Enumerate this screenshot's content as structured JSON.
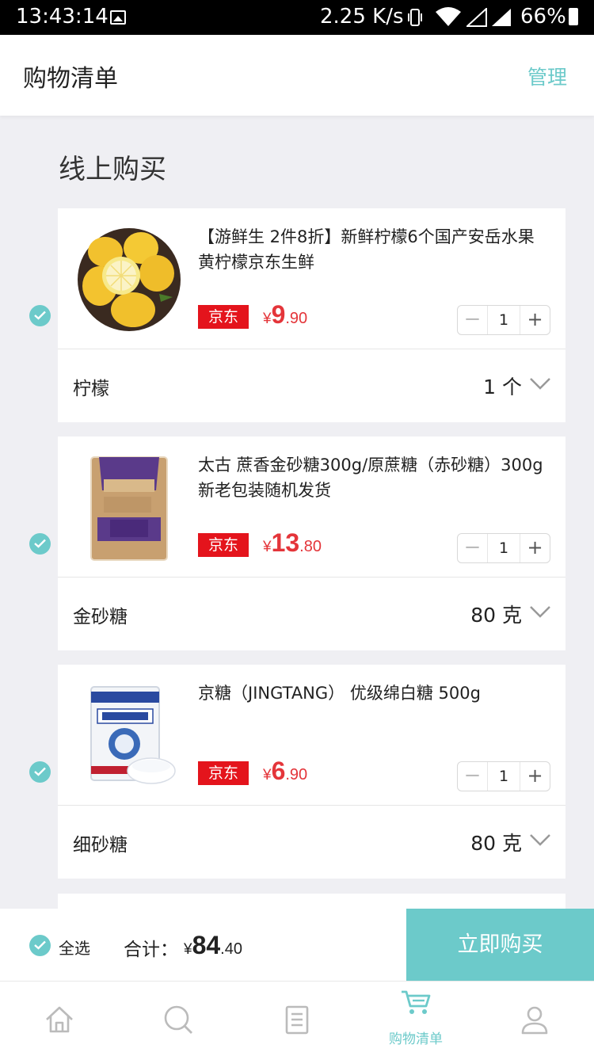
{
  "status_bar": {
    "time": "13:43:14",
    "speed": "2.25 K/s",
    "battery": "66%"
  },
  "header": {
    "title": "购物清单",
    "manage_label": "管理"
  },
  "section": {
    "title": "线上购买"
  },
  "items": [
    {
      "name": "【游鲜生 2件8折】新鲜柠檬6个国产安岳水果黄柠檬京东生鲜",
      "badge": "京东",
      "currency": "¥",
      "price_int": "9",
      "price_dec": ".90",
      "quantity": "1",
      "spec_label": "柠檬",
      "spec_value": "1 个",
      "selected": true
    },
    {
      "name": "太古 蔗香金砂糖300g/原蔗糖（赤砂糖）300g 新老包装随机发货",
      "badge": "京东",
      "currency": "¥",
      "price_int": "13",
      "price_dec": ".80",
      "quantity": "1",
      "spec_label": "金砂糖",
      "spec_value": "80 克",
      "selected": true
    },
    {
      "name": "京糖（JINGTANG） 优级绵白糖 500g",
      "badge": "京东",
      "currency": "¥",
      "price_int": "6",
      "price_dec": ".90",
      "quantity": "1",
      "spec_label": "细砂糖",
      "spec_value": "80 克",
      "selected": true
    }
  ],
  "stepper": {
    "minus": "−",
    "plus": "+"
  },
  "checkout": {
    "select_all": "全选",
    "total_label": "合计：",
    "currency": "¥",
    "total_int": "84",
    "total_dec": ".40",
    "buy_label": "立即购买"
  },
  "tabbar": {
    "tabs": [
      {
        "icon": "home-icon",
        "label": "",
        "active": false
      },
      {
        "icon": "search-icon",
        "label": "",
        "active": false
      },
      {
        "icon": "list-icon",
        "label": "",
        "active": false
      },
      {
        "icon": "cart-icon",
        "label": "购物清单",
        "active": true
      },
      {
        "icon": "profile-icon",
        "label": "",
        "active": false
      }
    ]
  },
  "colors": {
    "accent": "#6ccaca",
    "price": "#e4353a",
    "badge": "#e4141c"
  }
}
